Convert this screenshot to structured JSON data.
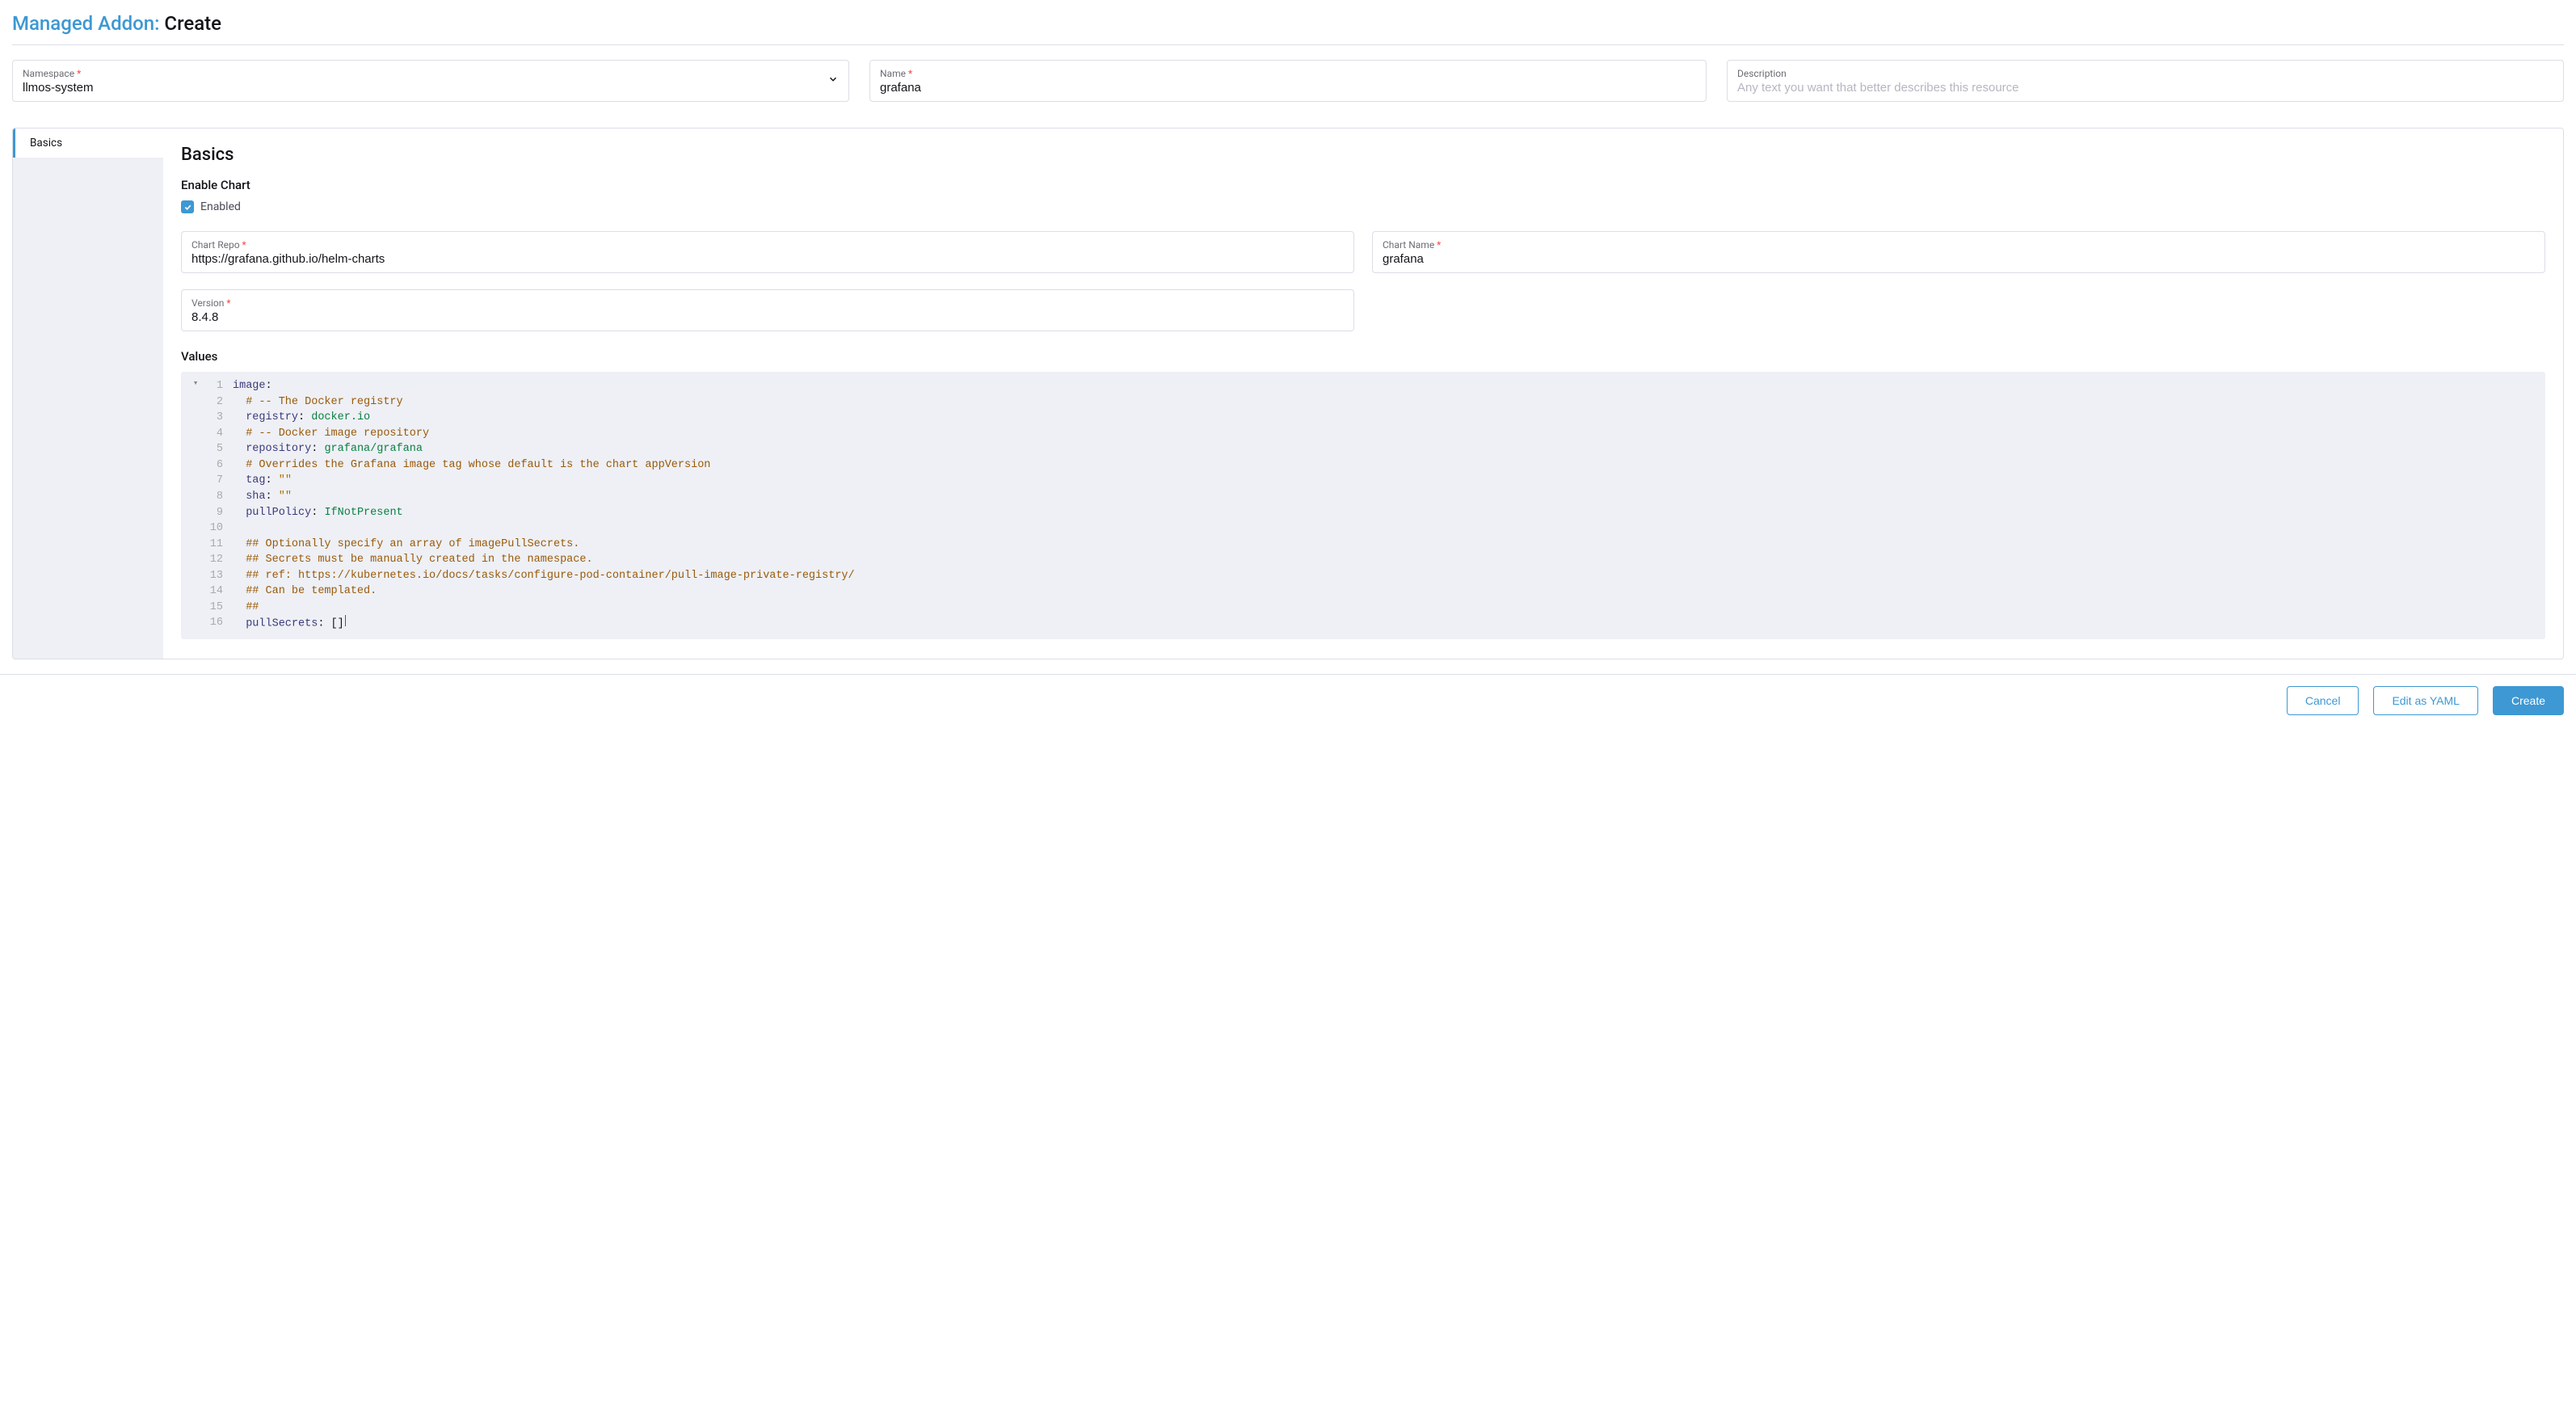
{
  "header": {
    "link_text": "Managed Addon:",
    "action_text": " Create"
  },
  "top_fields": {
    "namespace": {
      "label": "Namespace",
      "value": "llmos-system"
    },
    "name": {
      "label": "Name",
      "value": "grafana"
    },
    "description": {
      "label": "Description",
      "placeholder": "Any text you want that better describes this resource"
    }
  },
  "tabs": {
    "basics": "Basics"
  },
  "basics": {
    "title": "Basics",
    "enable_title": "Enable Chart",
    "enabled_label": "Enabled",
    "chart_repo": {
      "label": "Chart Repo",
      "value": "https://grafana.github.io/helm-charts"
    },
    "chart_name": {
      "label": "Chart Name",
      "value": "grafana"
    },
    "version": {
      "label": "Version",
      "value": "8.4.8"
    },
    "values_title": "Values",
    "yaml": {
      "l1_key": "image",
      "l2_cmt": "# -- The Docker registry",
      "l3_key": "registry",
      "l3_val": "docker.io",
      "l4_cmt": "# -- Docker image repository",
      "l5_key": "repository",
      "l5_val": "grafana/grafana",
      "l6_cmt": "# Overrides the Grafana image tag whose default is the chart appVersion",
      "l7_key": "tag",
      "l7_val": "\"\"",
      "l8_key": "sha",
      "l8_val": "\"\"",
      "l9_key": "pullPolicy",
      "l9_val": "IfNotPresent",
      "l11_cmt": "## Optionally specify an array of imagePullSecrets.",
      "l12_cmt": "## Secrets must be manually created in the namespace.",
      "l13_cmt": "## ref: https://kubernetes.io/docs/tasks/configure-pod-container/pull-image-private-registry/",
      "l14_cmt": "## Can be templated.",
      "l15_cmt": "##",
      "l16_key": "pullSecrets",
      "l16_val": "[]"
    }
  },
  "footer": {
    "cancel": "Cancel",
    "edit_yaml": "Edit as YAML",
    "create": "Create"
  }
}
